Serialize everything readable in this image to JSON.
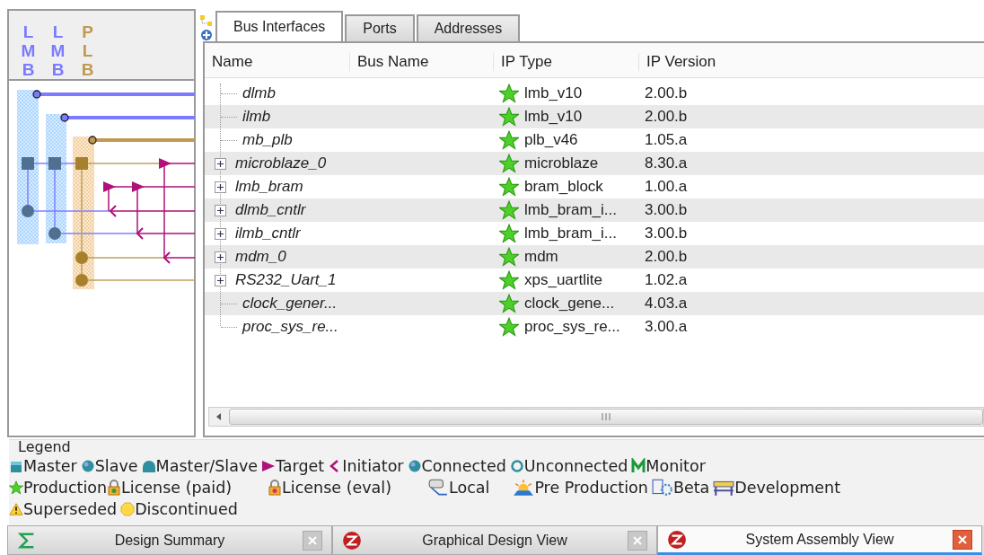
{
  "bus_headers": [
    {
      "label": "LMB",
      "color": "#7b7bff"
    },
    {
      "label": "LMB",
      "color": "#7b7bff"
    },
    {
      "label": "PLB",
      "color": "#c09a50"
    }
  ],
  "tabs": [
    {
      "label": "Bus Interfaces",
      "selected": true
    },
    {
      "label": "Ports",
      "selected": false
    },
    {
      "label": "Addresses",
      "selected": false
    }
  ],
  "table": {
    "columns": [
      "Name",
      "Bus Name",
      "IP Type",
      "IP Version"
    ],
    "rows": [
      {
        "name": "dlmb",
        "expandable": false,
        "ip_type": "lmb_v10",
        "ip_version": "2.00.b"
      },
      {
        "name": "ilmb",
        "expandable": false,
        "ip_type": "lmb_v10",
        "ip_version": "2.00.b"
      },
      {
        "name": "mb_plb",
        "expandable": false,
        "ip_type": "plb_v46",
        "ip_version": "1.05.a"
      },
      {
        "name": "microblaze_0",
        "expandable": true,
        "ip_type": "microblaze",
        "ip_version": "8.30.a"
      },
      {
        "name": "lmb_bram",
        "expandable": true,
        "ip_type": "bram_block",
        "ip_version": "1.00.a"
      },
      {
        "name": "dlmb_cntlr",
        "expandable": true,
        "ip_type": "lmb_bram_i...",
        "ip_version": "3.00.b"
      },
      {
        "name": "ilmb_cntlr",
        "expandable": true,
        "ip_type": "lmb_bram_i...",
        "ip_version": "3.00.b"
      },
      {
        "name": "mdm_0",
        "expandable": true,
        "ip_type": "mdm",
        "ip_version": "2.00.b"
      },
      {
        "name": "RS232_Uart_1",
        "expandable": true,
        "ip_type": "xps_uartlite",
        "ip_version": "1.02.a"
      },
      {
        "name": "clock_gener...",
        "expandable": false,
        "ip_type": "clock_gene...",
        "ip_version": "4.03.a"
      },
      {
        "name": "proc_sys_re...",
        "expandable": false,
        "ip_type": "proc_sys_re...",
        "ip_version": "3.00.a"
      }
    ]
  },
  "legend": {
    "title": "Legend",
    "lines": [
      {
        "items": [
          {
            "kind": "master",
            "label": "Master"
          },
          {
            "kind": "slave",
            "label": "Slave"
          },
          {
            "kind": "master_slave",
            "label": "Master/Slave"
          },
          {
            "kind": "target",
            "label": "Target"
          },
          {
            "kind": "initiator",
            "label": "Initiator"
          },
          {
            "kind": "connected",
            "label": "Connected"
          },
          {
            "kind": "unconnected",
            "label": "Unconnected"
          },
          {
            "kind": "monitor",
            "label": "Monitor"
          }
        ]
      },
      {
        "items": [
          {
            "kind": "production",
            "label": "Production"
          },
          {
            "kind": "license_paid",
            "label": "License (paid)"
          },
          {
            "kind": "license_eval",
            "label": "License (eval)"
          },
          {
            "kind": "local",
            "label": "Local"
          },
          {
            "kind": "pre_production",
            "label": "Pre Production"
          },
          {
            "kind": "beta",
            "label": "Beta"
          },
          {
            "kind": "development",
            "label": "Development"
          }
        ]
      },
      {
        "items": [
          {
            "kind": "superseded",
            "label": "Superseded"
          },
          {
            "kind": "discontinued",
            "label": "Discontinued"
          }
        ]
      }
    ]
  },
  "view_tabs": [
    {
      "label": "Design Summary",
      "kind": "summary",
      "selected": false
    },
    {
      "label": "Graphical Design View",
      "kind": "graphical",
      "selected": false
    },
    {
      "label": "System Assembly View",
      "kind": "assembly",
      "selected": true
    }
  ]
}
